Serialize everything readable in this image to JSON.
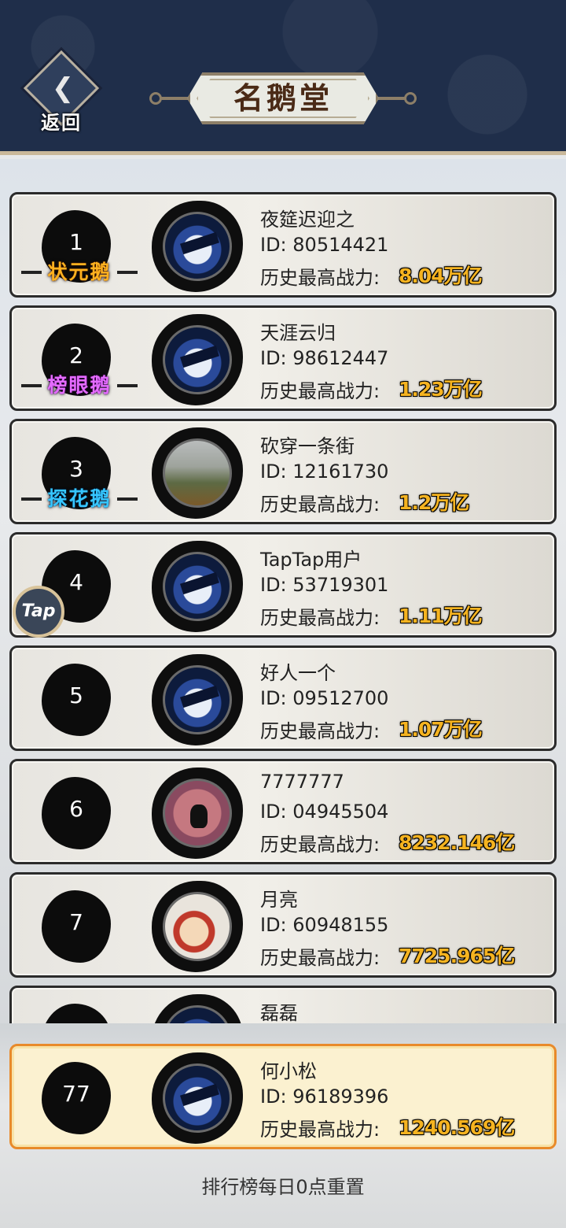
{
  "header": {
    "back_label": "返回",
    "title": "名鹅堂"
  },
  "floating": {
    "tap_label": "Tap"
  },
  "power_label": "历史最高战力:",
  "ranking": [
    {
      "rank": "1",
      "badge": "状元鹅",
      "name": "夜筵迟迎之",
      "id": "ID: 80514421",
      "power": "8.04万亿",
      "avatar": "knight-avatar"
    },
    {
      "rank": "2",
      "badge": "榜眼鹅",
      "name": "天涯云归",
      "id": "ID: 98612447",
      "power": "1.23万亿",
      "avatar": "knight-avatar"
    },
    {
      "rank": "3",
      "badge": "探花鹅",
      "name": "砍穿一条街",
      "id": "ID: 12161730",
      "power": "1.2万亿",
      "avatar": "forest-avatar"
    },
    {
      "rank": "4",
      "badge": "",
      "name": "TapTap用户",
      "id": "ID: 53719301",
      "power": "1.11万亿",
      "avatar": "knight-avatar"
    },
    {
      "rank": "5",
      "badge": "",
      "name": "好人一个",
      "id": "ID: 09512700",
      "power": "1.07万亿",
      "avatar": "knight-avatar"
    },
    {
      "rank": "6",
      "badge": "",
      "name": "7777777",
      "id": "ID: 04945504",
      "power": "8232.146亿",
      "avatar": "cat-avatar"
    },
    {
      "rank": "7",
      "badge": "",
      "name": "月亮",
      "id": "ID: 60948155",
      "power": "7725.965亿",
      "avatar": "shinchan-avatar"
    },
    {
      "rank": "",
      "badge": "",
      "name": "磊磊",
      "id": "",
      "power": "",
      "avatar": "knight-avatar"
    }
  ],
  "self": {
    "rank": "77",
    "name": "何小松",
    "id": "ID: 96189396",
    "power": "1240.569亿"
  },
  "footer": {
    "note": "排行榜每日0点重置"
  },
  "colors": {
    "header_bg": "#1f2e4a",
    "power_gold": "#f5b320",
    "self_border": "#e88a2a",
    "badge_gold": "#ffb11f",
    "badge_pink": "#e46bff",
    "badge_blue": "#36c6ff"
  }
}
